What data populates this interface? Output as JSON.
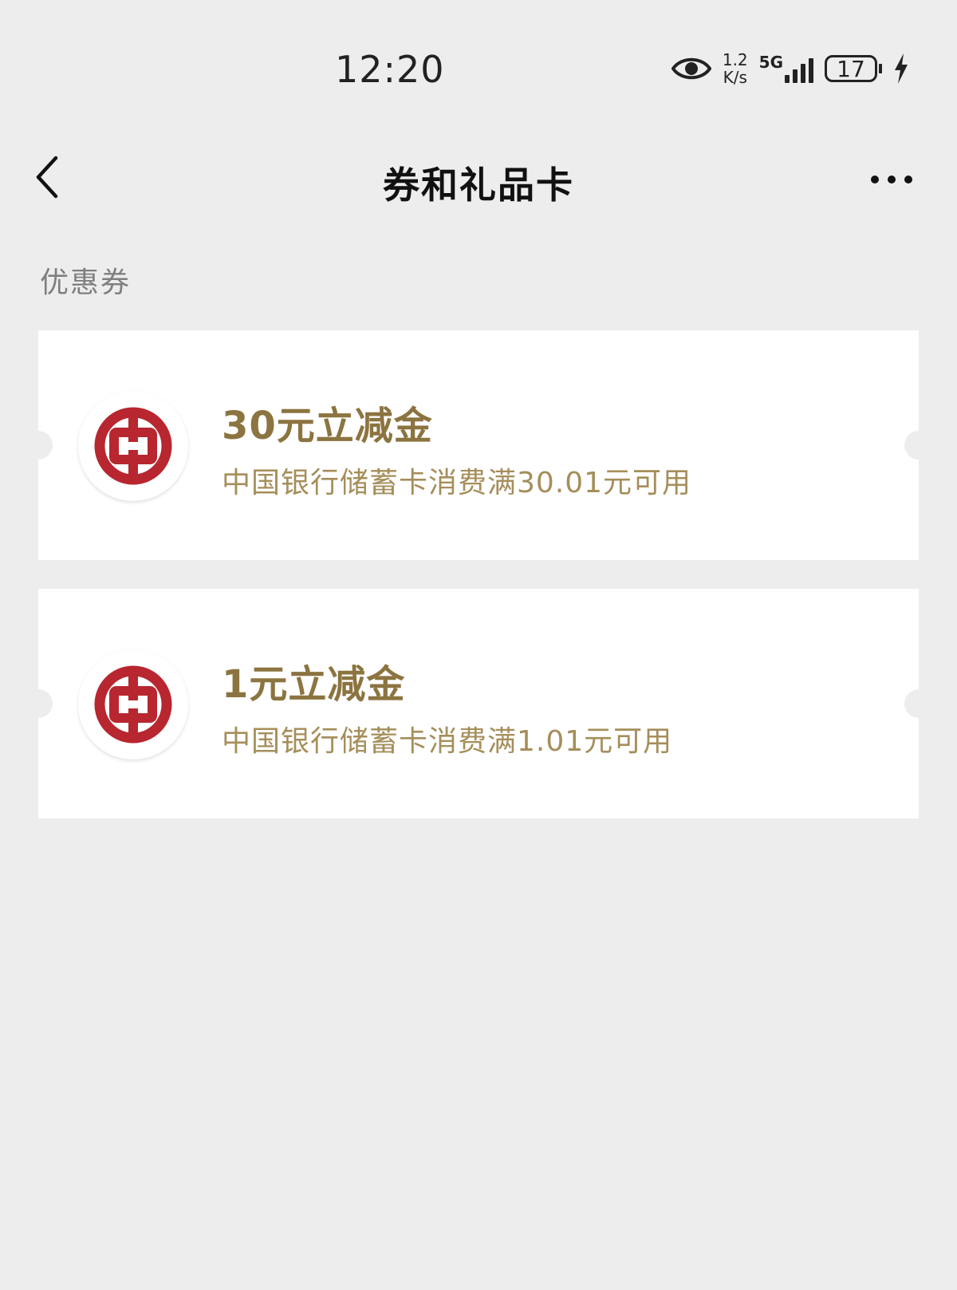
{
  "status_bar": {
    "time": "12:20",
    "speed_value": "1.2",
    "speed_unit": "K/s",
    "network_type": "5G",
    "battery_level": "17"
  },
  "nav": {
    "title": "券和礼品卡",
    "back_icon": "chevron-left-icon",
    "more_icon": "more-horizontal-icon"
  },
  "section": {
    "label": "优惠券"
  },
  "coupons": [
    {
      "title": "30元立减金",
      "description": "中国银行储蓄卡消费满30.01元可用",
      "logo_icon": "bank-of-china-logo"
    },
    {
      "title": "1元立减金",
      "description": "中国银行储蓄卡消费满1.01元可用",
      "logo_icon": "bank-of-china-logo"
    }
  ],
  "colors": {
    "background": "#ededed",
    "card": "#ffffff",
    "coupon_title": "#8c7440",
    "coupon_desc": "#a58e5a",
    "logo_red": "#b8262f"
  }
}
